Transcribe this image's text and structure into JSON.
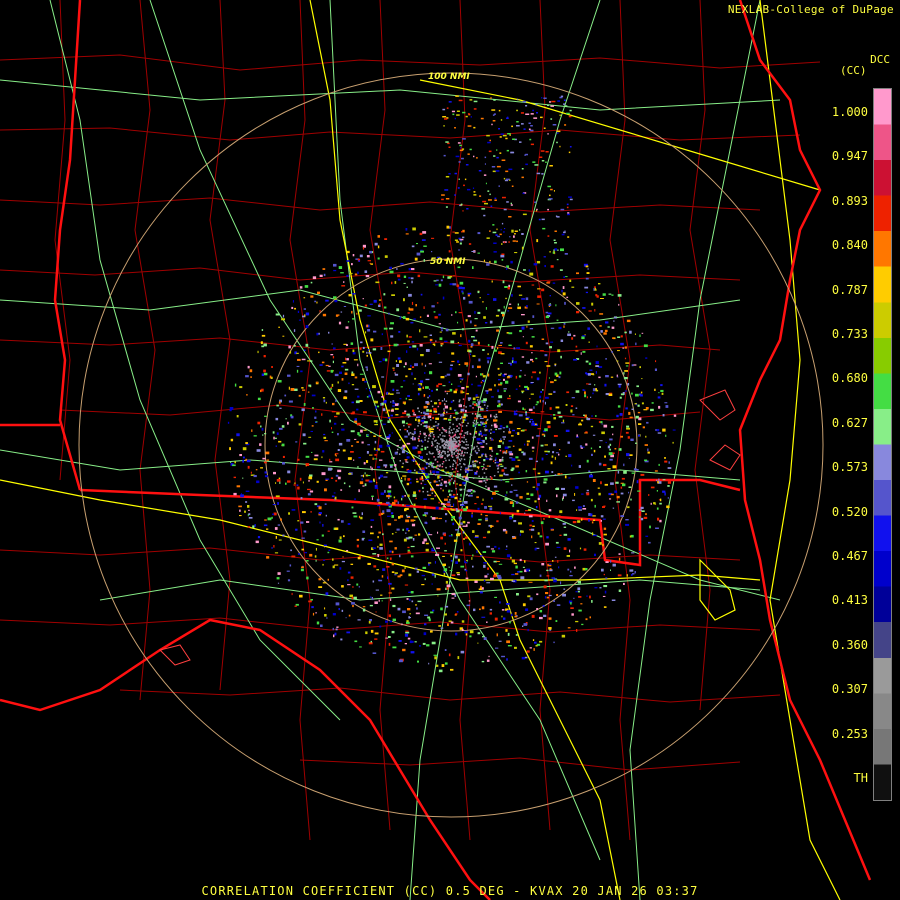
{
  "credit": "NEXLAB-College of DuPage",
  "product_code": "DCC",
  "unit": "(CC)",
  "ring_labels": {
    "inner": "50 NMI",
    "outer": "100 NMI"
  },
  "legend": {
    "ticks": [
      "1.000",
      "0.947",
      "0.893",
      "0.840",
      "0.787",
      "0.733",
      "0.680",
      "0.627",
      "0.573",
      "0.520",
      "0.467",
      "0.413",
      "0.360",
      "0.307",
      "0.253",
      "TH"
    ],
    "colors": [
      "#ff99cc",
      "#ee5588",
      "#cc1133",
      "#ee2200",
      "#ff7700",
      "#ffcc00",
      "#cccc00",
      "#88cc00",
      "#44dd44",
      "#88ee88",
      "#8888dd",
      "#5555cc",
      "#1111ee",
      "#0000cc",
      "#000099",
      "#444488",
      "#9a9a9a",
      "#888888",
      "#777777",
      "#101010"
    ]
  },
  "caption": "CORRELATION COEFFICIENT (CC) 0.5 DEG - KVAX 20 JAN 26 03:37",
  "colors": {
    "background": "#000000",
    "text": "#ffff40",
    "state_border": "#ff1010",
    "county_border": "#a00000",
    "highway": "#ffff00",
    "road": "#88ee88",
    "range_ring": "#c8a070"
  }
}
